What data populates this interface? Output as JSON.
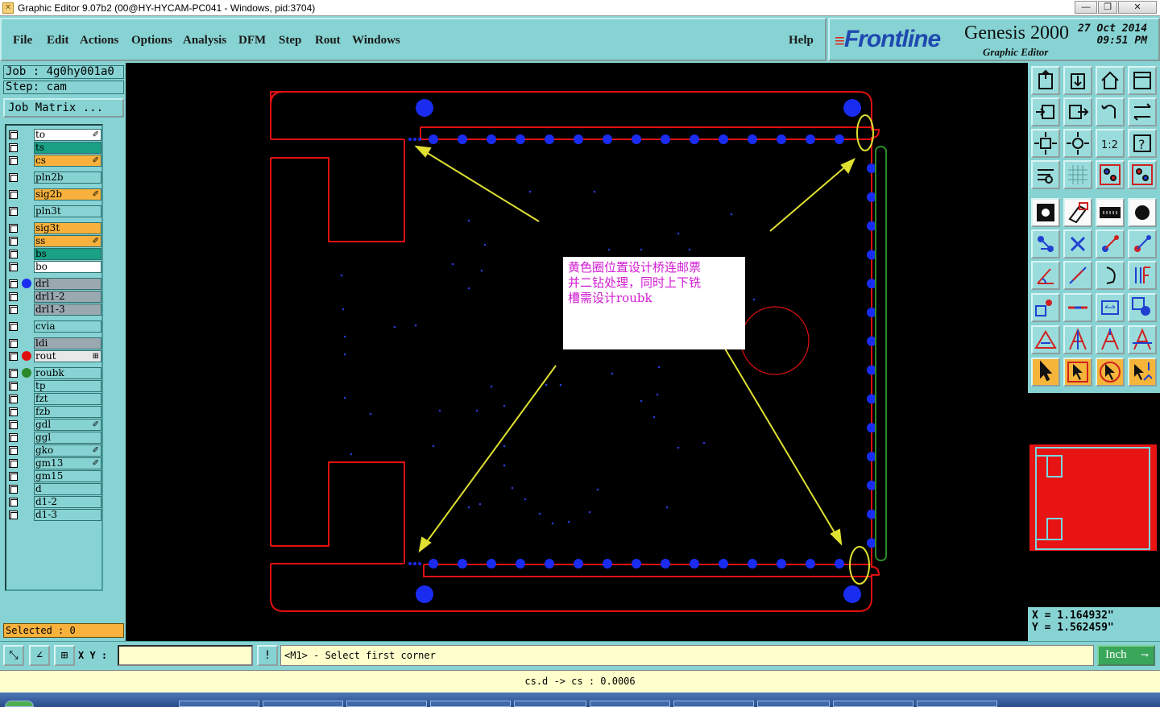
{
  "window": {
    "title": "Graphic Editor 9.07b2 (00@HY-HYCAM-PC041 - Windows, pid:3704)",
    "minimize": "—",
    "restore": "❐",
    "close": "✕"
  },
  "menu": {
    "items": [
      "File",
      "Edit",
      "Actions",
      "Options",
      "Analysis",
      "DFM",
      "Step",
      "Rout",
      "Windows"
    ],
    "help": "Help"
  },
  "brand": {
    "logo": "Frontline",
    "product": "Genesis 2000",
    "subtitle": "Graphic Editor",
    "date": "27 Oct 2014",
    "time": "09:51 PM"
  },
  "job": {
    "job_line": "Job : 4g0hy001a0",
    "step_line": "Step: cam",
    "matrix_button": "Job Matrix ..."
  },
  "layers": [
    {
      "name": "to",
      "color": "#ffffff",
      "mark": "✐",
      "dot": ""
    },
    {
      "name": "ts",
      "color": "#1aa085",
      "mark": "",
      "dot": ""
    },
    {
      "name": "cs",
      "color": "#f7b13c",
      "mark": "✐",
      "dot": ""
    },
    {
      "name": "pln2b",
      "color": "#87d3d3",
      "mark": "",
      "dot": ""
    },
    {
      "name": "sig2b",
      "color": "#f7b13c",
      "mark": "✐",
      "dot": ""
    },
    {
      "name": "pln3t",
      "color": "#87d3d3",
      "mark": "",
      "dot": ""
    },
    {
      "name": "sig3t",
      "color": "#f7b13c",
      "mark": "",
      "dot": ""
    },
    {
      "name": "ss",
      "color": "#f7b13c",
      "mark": "✐",
      "dot": ""
    },
    {
      "name": "bs",
      "color": "#1aa085",
      "mark": "",
      "dot": ""
    },
    {
      "name": "bo",
      "color": "#ffffff",
      "mark": "",
      "dot": ""
    },
    {
      "name": "drl",
      "color": "#9aa8b0",
      "mark": "",
      "dot": "#1a2cf0"
    },
    {
      "name": "drl1-2",
      "color": "#9aa8b0",
      "mark": "",
      "dot": ""
    },
    {
      "name": "drl1-3",
      "color": "#9aa8b0",
      "mark": "",
      "dot": ""
    },
    {
      "name": "cvia",
      "color": "#87d3d3",
      "mark": "",
      "dot": ""
    },
    {
      "name": "ldi",
      "color": "#9aa8b0",
      "mark": "",
      "dot": ""
    },
    {
      "name": "rout",
      "color": "#e8e8e8",
      "mark": "⊞",
      "dot": "#e01010"
    },
    {
      "name": "roubk",
      "color": "#87d3d3",
      "mark": "",
      "dot": "#2a8a2a"
    },
    {
      "name": "tp",
      "color": "#87d3d3",
      "mark": "",
      "dot": ""
    },
    {
      "name": "fzt",
      "color": "#87d3d3",
      "mark": "",
      "dot": ""
    },
    {
      "name": "fzb",
      "color": "#87d3d3",
      "mark": "",
      "dot": ""
    },
    {
      "name": "gdl",
      "color": "#87d3d3",
      "mark": "✐",
      "dot": ""
    },
    {
      "name": "ggl",
      "color": "#87d3d3",
      "mark": "",
      "dot": ""
    },
    {
      "name": "gko",
      "color": "#87d3d3",
      "mark": "✐",
      "dot": ""
    },
    {
      "name": "gm13",
      "color": "#87d3d3",
      "mark": "✐",
      "dot": ""
    },
    {
      "name": "gm15",
      "color": "#87d3d3",
      "mark": "",
      "dot": ""
    },
    {
      "name": "d",
      "color": "#87d3d3",
      "mark": "",
      "dot": ""
    },
    {
      "name": "d1-2",
      "color": "#87d3d3",
      "mark": "",
      "dot": ""
    },
    {
      "name": "d1-3",
      "color": "#87d3d3",
      "mark": "",
      "dot": ""
    }
  ],
  "selected": "Selected : 0",
  "annotation": {
    "lines": [
      "黄色圈位置设计桥连邮票",
      "并二钻处理，同时上下铣",
      "槽需设计roubk"
    ]
  },
  "coords": {
    "x": "X = 1.164932\"",
    "y": "Y = 1.562459\""
  },
  "status": {
    "xy_label": "X Y :",
    "xy_value": "",
    "warn_glyph": "!",
    "message": "<M1> - Select first corner",
    "units": "Inch",
    "units_arrow": "⇁",
    "bottom_info": "cs.d -> cs : 0.0006"
  },
  "colors": {
    "rout_outline": "#e01010",
    "drill": "#1a2cf0",
    "highlight": "#e0e030",
    "roubk": "#2a8a2a",
    "annotation_text": "#d21ad2"
  }
}
